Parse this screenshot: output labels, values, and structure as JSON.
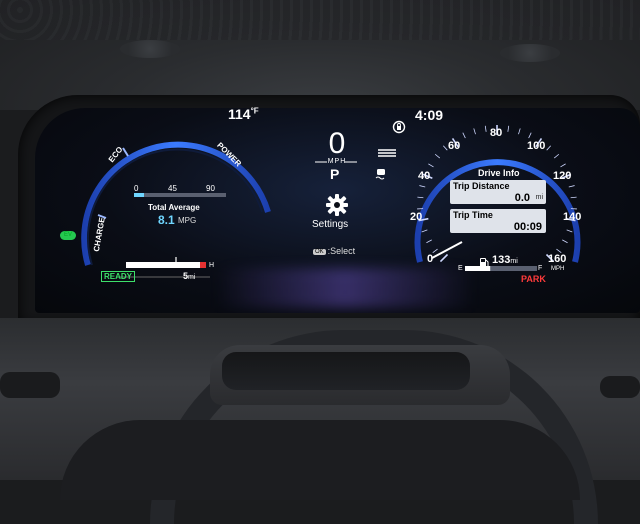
{
  "status": {
    "outside_temp": "114",
    "temp_unit": "°F",
    "time": "4:09"
  },
  "center": {
    "speed": "0",
    "speed_unit": "MPH",
    "gear": "P",
    "settings_label": "Settings",
    "select_button": "OK",
    "select_label": ":Select"
  },
  "hybrid_gauge": {
    "eco_label": "ECO",
    "power_label": "POWER",
    "charge_label": "CHARGE",
    "scale": [
      "0",
      "45",
      "90"
    ],
    "average_title": "Total Average",
    "average_value": "8.1",
    "average_unit": "MPG",
    "ready_label": "READY",
    "range_value": "5",
    "range_unit": "mi",
    "temp_high_label": "H",
    "ev_badge": "EV"
  },
  "speedometer": {
    "ticks": [
      "0",
      "20",
      "40",
      "60",
      "80",
      "100",
      "120",
      "140",
      "160"
    ],
    "unit": "MPH"
  },
  "drive_info": {
    "title": "Drive Info",
    "trip_distance_label": "Trip Distance",
    "trip_distance_value": "0.0",
    "trip_distance_unit": "mi",
    "trip_time_label": "Trip Time",
    "trip_time_value": "00:09"
  },
  "fuel": {
    "empty_label": "E",
    "full_label": "F",
    "range_value": "133",
    "range_unit": "mi",
    "level": 0.35,
    "park_label": "PARK"
  },
  "colors": {
    "gauge_blue": "#2f6bff",
    "accent_cyan": "#6fd6ff",
    "ready_green": "#3ee06a",
    "park_red": "#ff3b3b"
  }
}
